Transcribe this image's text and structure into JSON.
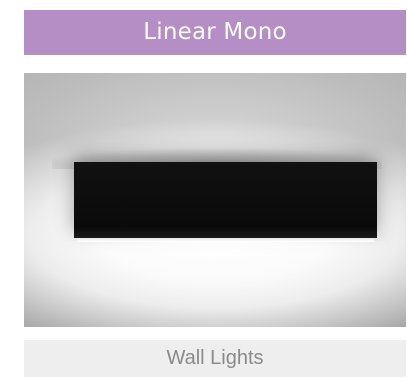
{
  "product": {
    "title": "Linear Mono",
    "category": "Wall Lights",
    "image_subject": "black-linear-wall-light-photo"
  },
  "colors": {
    "title_banner_bg": "#b48ec4",
    "title_text": "#ffffff",
    "category_bg": "#eeeeee",
    "category_text": "#8a8a8a"
  }
}
